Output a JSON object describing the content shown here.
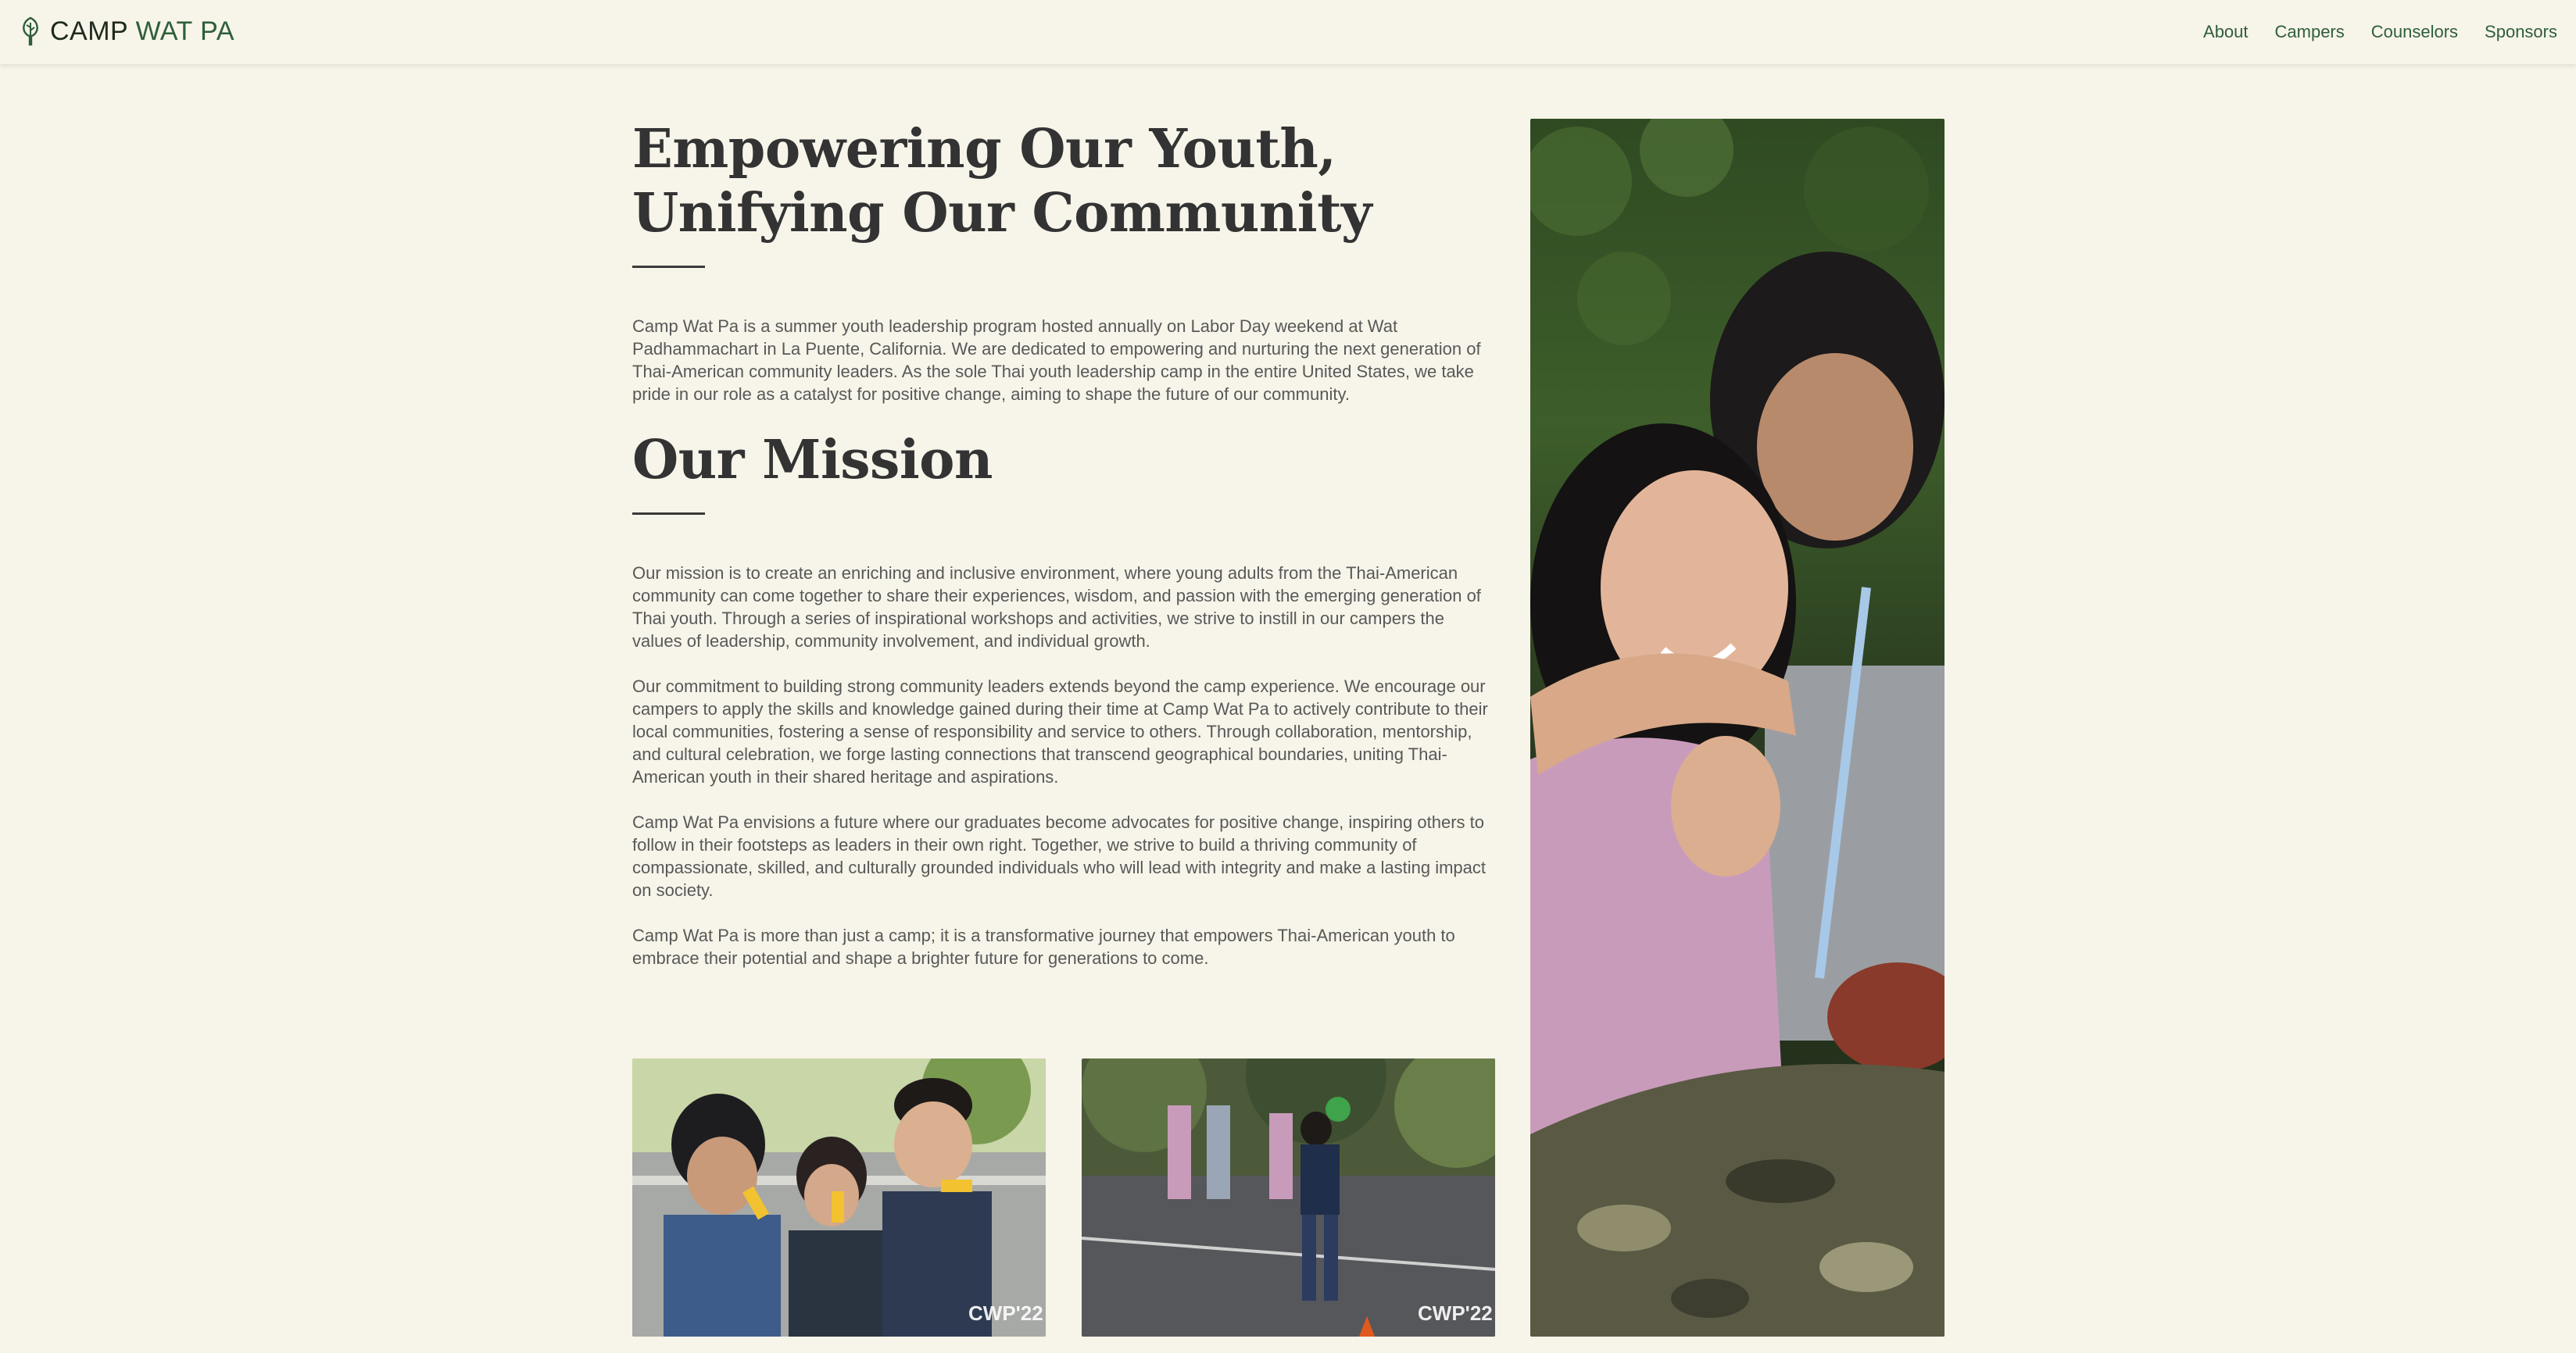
{
  "brand": {
    "name_part1": "CAMP ",
    "name_part2": "WAT PA",
    "icon": "tree-icon"
  },
  "nav": {
    "items": [
      {
        "label": "About"
      },
      {
        "label": "Campers"
      },
      {
        "label": "Counselors"
      },
      {
        "label": "Sponsors"
      }
    ]
  },
  "hero": {
    "title": "Empowering Our Youth, Unifying Our Community",
    "intro": "Camp Wat Pa is a summer youth leadership program hosted annually on Labor Day weekend at Wat Padhammachart in La Puente, California. We are dedicated to empowering and nurturing the next generation of Thai-American community leaders. As the sole Thai youth leadership camp in the entire United States, we take pride in our role as a catalyst for positive change, aiming to shape the future of our community."
  },
  "mission": {
    "title": "Our Mission",
    "paragraphs": [
      "Our mission is to create an enriching and inclusive environment, where young adults from the Thai-American community can come together to share their experiences, wisdom, and passion with the emerging generation of Thai youth. Through a series of inspirational workshops and activities, we strive to instill in our campers the values of leadership, community involvement, and individual growth.",
      "Our commitment to building strong community leaders extends beyond the camp experience. We encourage our campers to apply the skills and knowledge gained during their time at Camp Wat Pa to actively contribute to their local communities, fostering a sense of responsibility and service to others. Through collaboration, mentorship, and cultural celebration, we forge lasting connections that transcend geographical boundaries, uniting Thai-American youth in their shared heritage and aspirations.",
      "Camp Wat Pa envisions a future where our graduates become advocates for positive change, inspiring others to follow in their footsteps as leaders in their own right. Together, we strive to build a thriving community of compassionate, skilled, and culturally grounded individuals who will lead with integrity and make a lasting impact on society.",
      "Camp Wat Pa is more than just a camp; it is a transformative journey that empowers Thai-American youth to embrace their potential and shape a brighter future for generations to come."
    ]
  },
  "photos": {
    "watermark": "CWP'22"
  },
  "colors": {
    "background": "#f7f4e9",
    "accent_green": "#2e5e3a",
    "heading": "#333333",
    "body_text": "#585858"
  }
}
